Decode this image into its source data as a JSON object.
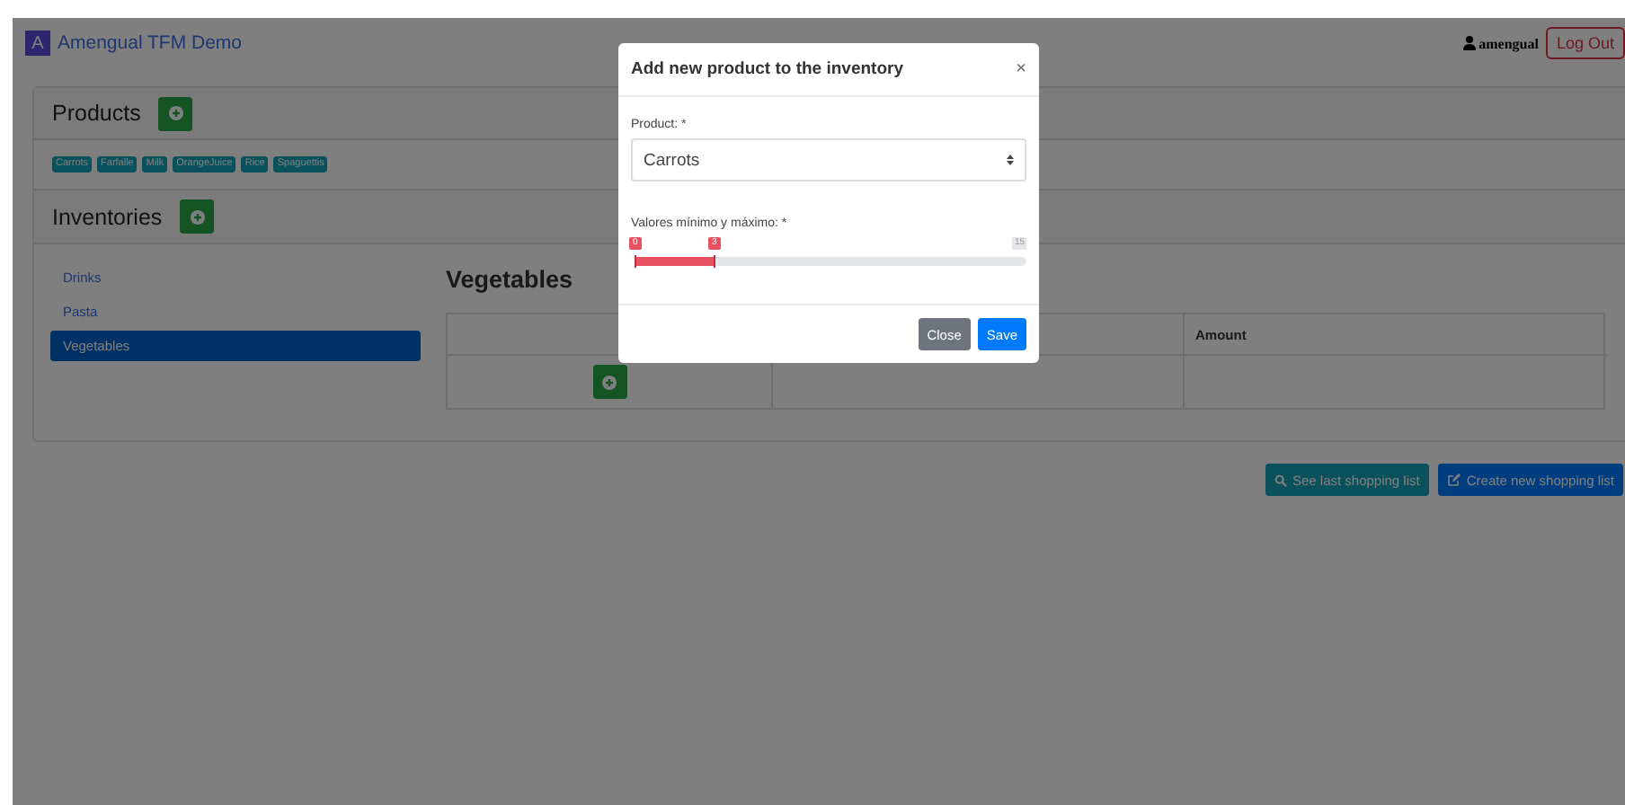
{
  "navbar": {
    "brand_letter": "A",
    "brand": "Amengual TFM Demo",
    "user": "amengual",
    "logout": "Log Out"
  },
  "products": {
    "title": "Products",
    "tags": [
      "Carrots",
      "Farfalle",
      "Milk",
      "OrangeJuice",
      "Rice",
      "Spaguettis"
    ]
  },
  "inventories": {
    "title": "Inventories",
    "items": [
      {
        "label": "Drinks",
        "selected": false
      },
      {
        "label": "Pasta",
        "selected": false
      },
      {
        "label": "Vegetables",
        "selected": true
      }
    ]
  },
  "inventory": {
    "title": "Vegetables",
    "columns": [
      "Amount"
    ]
  },
  "actions": [
    {
      "label": "See last shopping list",
      "kind": "search"
    },
    {
      "label": "Create new shopping list",
      "kind": "create"
    }
  ],
  "modal": {
    "title": "Add new product to the inventory",
    "close": "×",
    "product_label": "Product: *",
    "product_value": "Carrots",
    "range_label": "Valores mínimo y máximo: *",
    "max_label": "15",
    "handles": [
      {
        "label": "0",
        "level": 0
      },
      {
        "label": "3",
        "level": 0.2
      }
    ],
    "buttons": [
      {
        "label": "Close",
        "kind": "secondary"
      },
      {
        "label": "Save",
        "kind": "primary"
      }
    ]
  }
}
